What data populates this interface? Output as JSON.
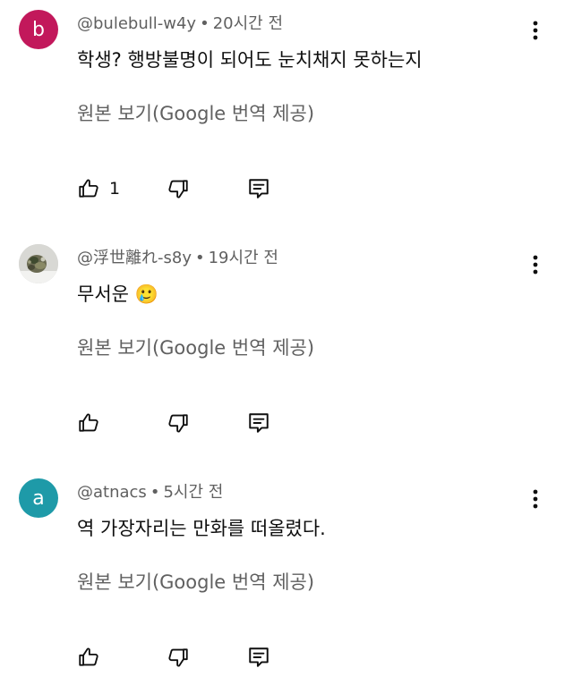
{
  "comments": [
    {
      "avatar_letter": "b",
      "avatar_color": "#c2185b",
      "handle": "@bulebull-w4y",
      "separator": "•",
      "time": "20시간 전",
      "text": "학생? 행방불명이 되어도 눈치채지 못하는지",
      "translate_label": "원본 보기(Google 번역 제공)",
      "like_count": "1"
    },
    {
      "avatar_letter": "",
      "avatar_color": "#cfcfcf",
      "handle": "@浮世離れ-s8y",
      "separator": "•",
      "time": "19시간 전",
      "text": "무서운 🥲",
      "translate_label": "원본 보기(Google 번역 제공)",
      "like_count": ""
    },
    {
      "avatar_letter": "a",
      "avatar_color": "#1e9aa8",
      "handle": "@atnacs",
      "separator": "•",
      "time": "5시간 전",
      "text": "역 가장자리는 만화를 떠올렸다.",
      "translate_label": "원본 보기(Google 번역 제공)",
      "like_count": ""
    }
  ],
  "icons": {
    "like": "thumb-up-icon",
    "dislike": "thumb-down-icon",
    "reply": "comment-reply-icon",
    "more": "more-vertical-icon"
  }
}
